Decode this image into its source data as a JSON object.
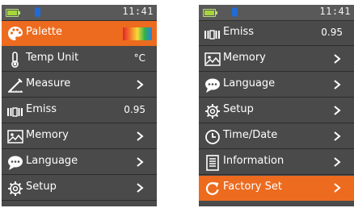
{
  "left_screen": {
    "status": {
      "time": "11:41"
    },
    "items": [
      {
        "label": "Palette",
        "icon": "palette-icon"
      },
      {
        "label": "Temp Unit",
        "value": "°C",
        "icon": "thermometer-icon"
      },
      {
        "label": "Measure",
        "icon": "measure-icon"
      },
      {
        "label": "Emiss",
        "value": "0.95",
        "icon": "emissivity-icon"
      },
      {
        "label": "Memory",
        "icon": "image-icon"
      },
      {
        "label": "Language",
        "icon": "speech-bubble-icon"
      },
      {
        "label": "Setup",
        "icon": "gear-icon"
      }
    ]
  },
  "right_screen": {
    "status": {
      "time": "11:41"
    },
    "items": [
      {
        "label": "Emiss",
        "value": "0.95",
        "icon": "emissivity-icon"
      },
      {
        "label": "Memory",
        "icon": "image-icon"
      },
      {
        "label": "Language",
        "icon": "speech-bubble-icon"
      },
      {
        "label": "Setup",
        "icon": "gear-icon"
      },
      {
        "label": "Time/Date",
        "icon": "clock-icon"
      },
      {
        "label": "Information",
        "icon": "document-icon"
      },
      {
        "label": "Factory Set",
        "icon": "reset-icon"
      }
    ]
  },
  "colors": {
    "accent": "#ec6b1f",
    "background": "#4a4a4a",
    "statusbar": "#595959"
  }
}
